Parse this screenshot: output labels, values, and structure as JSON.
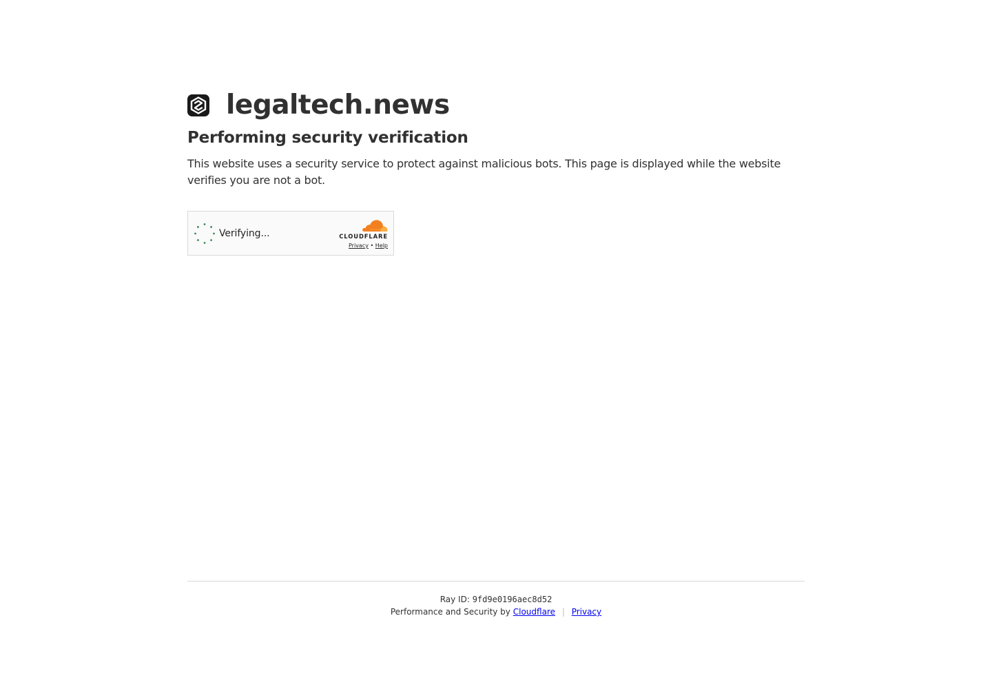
{
  "site": {
    "name": "legaltech.news",
    "logo_icon": "site-shield-icon"
  },
  "page": {
    "headline": "Performing security verification",
    "description": "This website uses a security service to protect against malicious bots. This page is displayed while the website verifies you are not a bot."
  },
  "widget": {
    "status_text": "Verifying...",
    "spinner_icon": "loading-spinner-icon",
    "spinner_color": "#3a8a5a",
    "brand_logo_icon": "cloudflare-cloud-icon",
    "brand_name": "CLOUDFLARE",
    "brand_color": "#f38020",
    "privacy_label": "Privacy",
    "link_separator": "•",
    "help_label": "Help"
  },
  "footer": {
    "ray_label": "Ray ID:",
    "ray_id": "9fd9e0196aec8d52",
    "performance_text": "Performance and Security by",
    "cloudflare_link": "Cloudflare",
    "separator": "|",
    "privacy_link": "Privacy"
  }
}
